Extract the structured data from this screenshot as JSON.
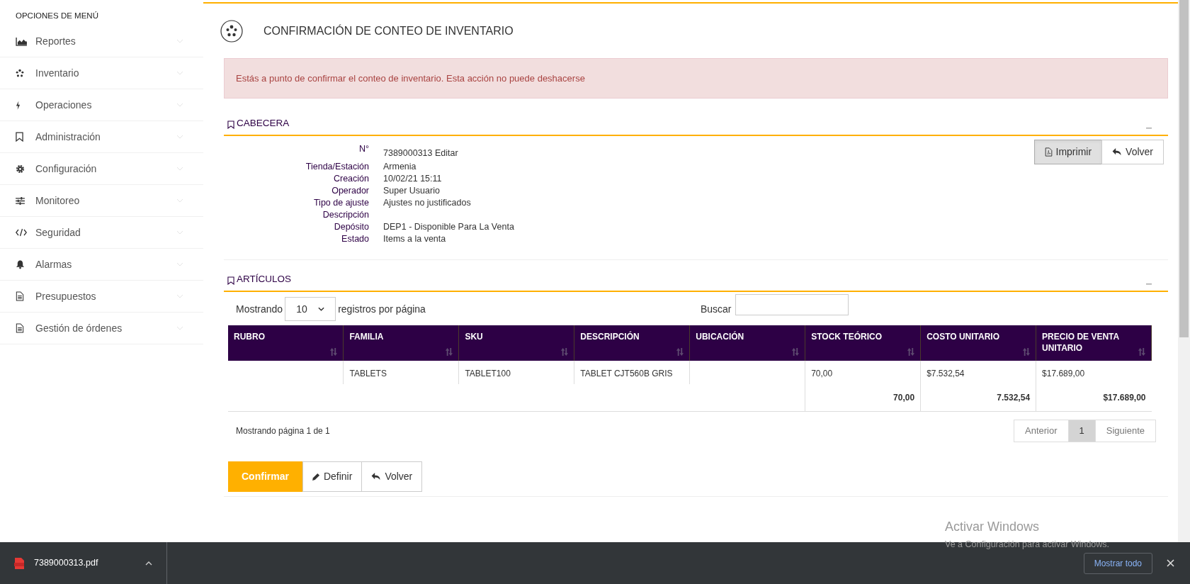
{
  "sidebar": {
    "heading": "OPCIONES DE MENÚ",
    "items": [
      {
        "label": "Reportes"
      },
      {
        "label": "Inventario"
      },
      {
        "label": "Operaciones"
      },
      {
        "label": "Administración"
      },
      {
        "label": "Configuración"
      },
      {
        "label": "Monitoreo"
      },
      {
        "label": "Seguridad"
      },
      {
        "label": "Alarmas"
      },
      {
        "label": "Presupuestos"
      },
      {
        "label": "Gestión de órdenes"
      }
    ]
  },
  "page_title": "CONFIRMACIÓN DE CONTEO DE INVENTARIO",
  "alert": "Estás a punto de confirmar el conteo de inventario. Esta acción no puede deshacerse",
  "header_section": {
    "title": "CABECERA",
    "fields": [
      {
        "label": "N°",
        "value": "7389000313 Editar"
      },
      {
        "label": "Tienda/Estación",
        "value": "Armenia"
      },
      {
        "label": "Creación",
        "value": "10/02/21 15:11"
      },
      {
        "label": "Operador",
        "value": "Super Usuario"
      },
      {
        "label": "Tipo de ajuste",
        "value": "Ajustes no justificados"
      },
      {
        "label": "Descripción"
      },
      {
        "label": "Depósito",
        "value": "DEP1 - Disponible Para La Venta"
      },
      {
        "label": "Estado",
        "value": "Items a la venta"
      }
    ],
    "buttons": [
      {
        "label": "Imprimir",
        "kind": "print",
        "pressed": true
      },
      {
        "label": "Volver",
        "kind": "back",
        "pressed": false
      }
    ]
  },
  "items_section": {
    "title": "ARTÍCULOS",
    "length_menu": {
      "prefix": "Mostrando",
      "value": "10",
      "suffix": "registros por página"
    },
    "search": {
      "label": "Buscar"
    },
    "table": {
      "columns": [
        "RUBRO",
        "FAMILIA",
        "SKU",
        "DESCRIPCIÓN",
        "UBICACIÓN",
        "STOCK TEÓRICO",
        "COSTO UNITARIO",
        "PRECIO DE VENTA UNITARIO"
      ],
      "rows": [
        [
          "",
          "TABLETS",
          "TABLET100",
          "TABLET CJT560B GRIS",
          "",
          "70,00",
          "$7.532,54",
          "$17.689,00"
        ]
      ],
      "totals": [
        "70,00",
        "7.532,54",
        "$17.689,00"
      ]
    },
    "info": "Mostrando página 1 de 1",
    "pagination": [
      {
        "label": "Anterior",
        "selected": false
      },
      {
        "label": "1",
        "selected": true
      },
      {
        "label": "Siguiente",
        "selected": false
      }
    ],
    "actions": [
      {
        "label": "Confirmar",
        "kind": "primary"
      },
      {
        "label": "Definir",
        "kind": "edit"
      },
      {
        "label": "Volver",
        "kind": "back"
      }
    ]
  },
  "os_notice": {
    "title": "Activar Windows",
    "text": "Ve a Configuración para activar Windows."
  },
  "download_bar": {
    "file": "7389000313.pdf",
    "button": "Mostrar todo"
  }
}
